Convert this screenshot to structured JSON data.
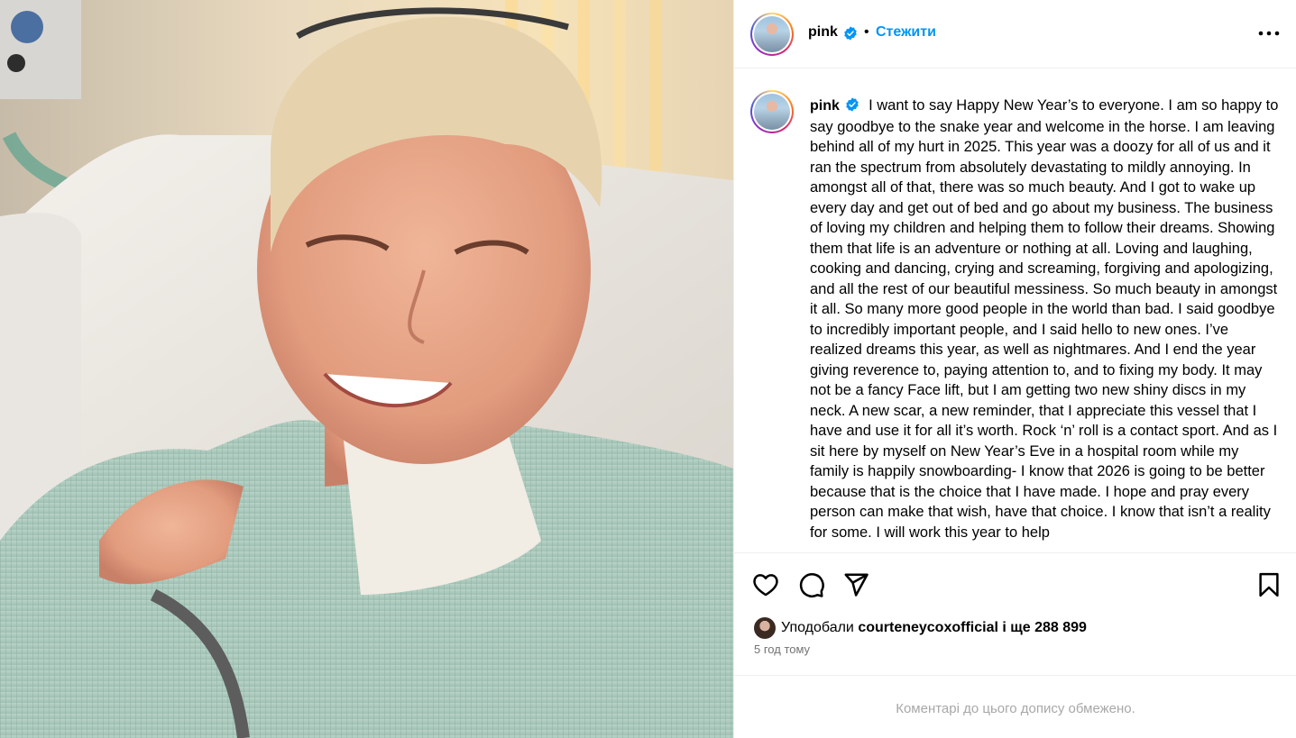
{
  "post": {
    "author": "pink",
    "verified": true,
    "separator": "•",
    "follow_label": "Стежити",
    "more_icon": "more-horizontal-icon",
    "caption": "I want to say Happy New Year’s to everyone. I am so happy to say goodbye to the snake year and welcome in the horse. I am leaving behind all of my hurt in 2025. This year was a doozy for all of us and it ran the spectrum from absolutely devastating to mildly annoying. In amongst all of that, there was so much beauty. And I got to wake up every day and get out of bed and go about my business. The business of loving my children and helping them to follow their dreams. Showing them that life is an adventure or nothing at all. Loving and laughing, cooking and dancing, crying and screaming, forgiving and apologizing, and all the rest of our beautiful messiness. So much beauty in amongst it all. So many more good people in the world than bad. I said goodbye to incredibly important people, and I said hello to new ones. I’ve realized dreams this year, as well as nightmares. And I end the year giving reverence to, paying attention to, and to fixing my body. It may not be a fancy Face lift, but I am getting two new shiny discs in my neck. A new scar, a new reminder, that I appreciate this vessel that I have and use it for all it’s worth. Rock ‘n’ roll is a contact sport. And as I sit here by myself on New Year’s Eve in a hospital room while my family is happily snowboarding- I know that 2026 is going to be better because that is the choice that I have made. I hope and pray every person can make that wish, have that choice. I know that isn’t a reality for some. I will work this year to help"
  },
  "actions": {
    "like_icon": "heart-icon",
    "comment_icon": "comment-icon",
    "share_icon": "share-icon",
    "save_icon": "bookmark-icon"
  },
  "likes": {
    "prefix": "Уподобали",
    "user": "courteneycoxofficial",
    "suffix": "і ще 288 899"
  },
  "timestamp": "5 год тому",
  "comments_notice": "Коментарі до цього допису обмежено.",
  "colors": {
    "follow_blue": "#0095f6",
    "verified_blue": "#0095f6",
    "muted_text": "#737373",
    "notice_text": "#a8a8a8",
    "divider": "#efefef"
  }
}
